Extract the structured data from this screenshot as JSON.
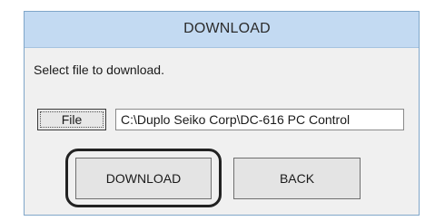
{
  "window": {
    "title": "DOWNLOAD"
  },
  "prompt": "Select file to download.",
  "file_button": {
    "label": "File"
  },
  "path_field": {
    "value": "C:\\Duplo Seiko Corp\\DC-616 PC Control"
  },
  "actions": {
    "download_label": "DOWNLOAD",
    "back_label": "BACK"
  },
  "colors": {
    "titlebar": "#c3daf2",
    "dialog_bg": "#f0f0f0",
    "border": "#7fa6c9",
    "highlight": "#222222"
  }
}
